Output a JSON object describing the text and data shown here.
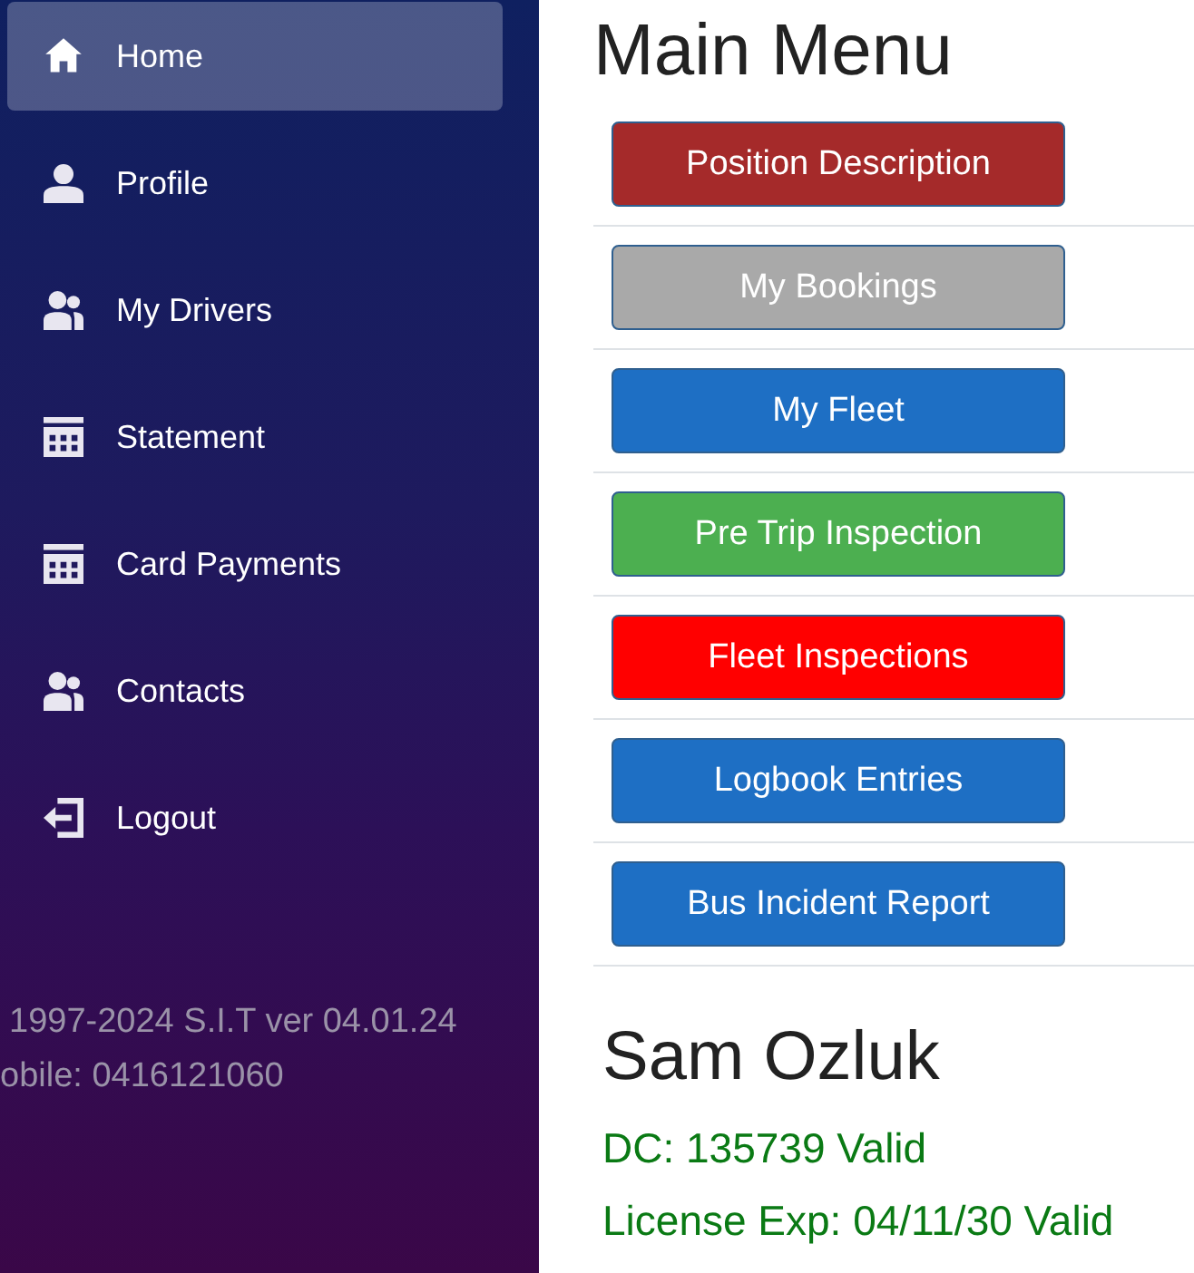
{
  "sidebar": {
    "items": [
      {
        "label": "Home",
        "kind": "home",
        "selected": true
      },
      {
        "label": "Profile",
        "kind": "profile",
        "selected": false
      },
      {
        "label": "My Drivers",
        "kind": "people",
        "selected": false
      },
      {
        "label": "Statement",
        "kind": "statement",
        "selected": false
      },
      {
        "label": "Card Payments",
        "kind": "statement",
        "selected": false
      },
      {
        "label": "Contacts",
        "kind": "people",
        "selected": false
      },
      {
        "label": "Logout",
        "kind": "logout",
        "selected": false
      }
    ],
    "footer": [
      "1997-2024 S.I.T ver 04.01.24",
      "obile: 0416121060"
    ]
  },
  "main": {
    "title": "Main Menu",
    "buttons": [
      {
        "label": "Position Description",
        "color": "#a52a2a"
      },
      {
        "label": "My Bookings",
        "color": "#a9a9a9"
      },
      {
        "label": "My Fleet",
        "color": "#1e6fc4"
      },
      {
        "label": "Pre Trip Inspection",
        "color": "#4caf50"
      },
      {
        "label": "Fleet Inspections",
        "color": "#ff0000"
      },
      {
        "label": "Logbook Entries",
        "color": "#1e6fc4"
      },
      {
        "label": "Bus Incident Report",
        "color": "#1e6fc4"
      }
    ],
    "user": {
      "name": "Sam Ozluk",
      "details": [
        "DC: 135739 Valid",
        "License Exp: 04/11/30 Valid"
      ]
    }
  }
}
